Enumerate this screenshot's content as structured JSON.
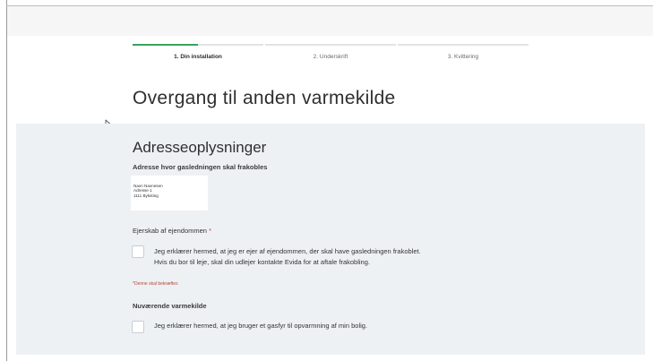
{
  "steps": [
    {
      "label": "1. Din installation",
      "active": true,
      "progress": 0.5
    },
    {
      "label": "2. Underskrift",
      "active": false,
      "progress": 0
    },
    {
      "label": "3. Kvittering",
      "active": false,
      "progress": 0
    }
  ],
  "page_title": "Overgang til anden varmekilde",
  "address_section": {
    "title": "Adresseoplysninger",
    "subheading": "Adresse hvor gasledningen skal frakobles",
    "address_lines": [
      "Navn Navnesen",
      "Adresse 1",
      "1111 Byksting"
    ]
  },
  "ownership": {
    "label": "Ejerskab af ejendommen",
    "required_marker": "*",
    "checkbox_text_line1": "Jeg erklærer hermed, at jeg er ejer af ejendommen, der skal have gasledningen frakoblet.",
    "checkbox_text_line2": "Hvis du bor til leje, skal din udlejer kontakte Evida for at aftale frakobling.",
    "checked": false,
    "required_hint_star": "*",
    "required_hint": "Denne skal bekræftes"
  },
  "current_heating": {
    "label": "Nuværende varmekilde",
    "checkbox_text": "Jeg erklærer hermed, at jeg bruger et gasfyr til opvarmning af min bolig.",
    "checked": false
  },
  "colors": {
    "accent": "#3aa35c",
    "panel": "#eef1f4",
    "required": "#d03a3a"
  }
}
